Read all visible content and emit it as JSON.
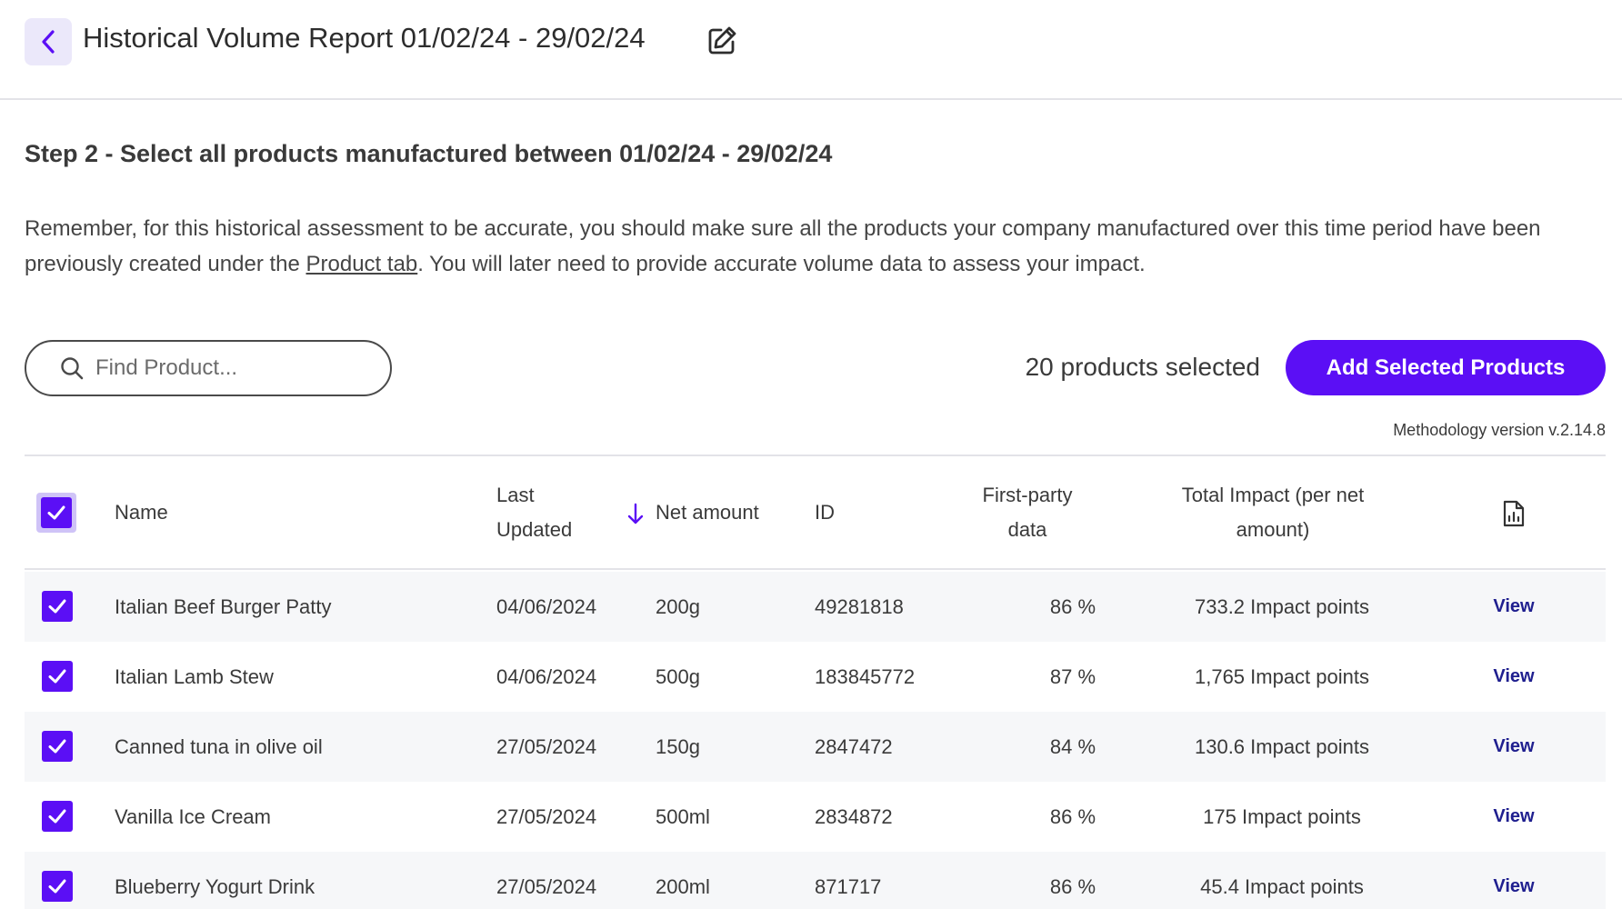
{
  "header": {
    "title": "Historical Volume Report 01/02/24 - 29/02/24"
  },
  "step": {
    "title": "Step 2 - Select all products manufactured between 01/02/24 - 29/02/24",
    "info_before": "Remember, for this historical assessment to be accurate, you should make sure all the products your company manufactured over this time period have been previously created under the ",
    "info_link": "Product tab",
    "info_after": ". You will later need to provide accurate volume data to assess your impact."
  },
  "search": {
    "placeholder": "Find Product..."
  },
  "selection": {
    "count_text": "20 products selected",
    "add_button": "Add Selected Products"
  },
  "methodology": "Methodology version v.2.14.8",
  "table": {
    "columns": {
      "name": "Name",
      "last_updated_1": "Last",
      "last_updated_2": "Updated",
      "net_amount": "Net amount",
      "id": "ID",
      "first_party_1": "First-party",
      "first_party_2": "data",
      "impact_1": "Total Impact (per net",
      "impact_2": "amount)"
    },
    "sort_icon": "arrow-down-icon",
    "report_icon": "document-chart-icon",
    "rows": [
      {
        "name": "Italian Beef Burger Patty",
        "updated": "04/06/2024",
        "net": "200g",
        "id": "49281818",
        "first_party": "86 %",
        "impact": "733.2 Impact points",
        "action": "View",
        "checked": true
      },
      {
        "name": "Italian Lamb Stew",
        "updated": "04/06/2024",
        "net": "500g",
        "id": "183845772",
        "first_party": "87 %",
        "impact": "1,765 Impact points",
        "action": "View",
        "checked": true
      },
      {
        "name": "Canned tuna in olive oil",
        "updated": "27/05/2024",
        "net": "150g",
        "id": "2847472",
        "first_party": "84 %",
        "impact": "130.6 Impact points",
        "action": "View",
        "checked": true
      },
      {
        "name": "Vanilla Ice Cream",
        "updated": "27/05/2024",
        "net": "500ml",
        "id": "2834872",
        "first_party": "86 %",
        "impact": "175 Impact points",
        "action": "View",
        "checked": true
      },
      {
        "name": "Blueberry Yogurt Drink",
        "updated": "27/05/2024",
        "net": "200ml",
        "id": "871717",
        "first_party": "86 %",
        "impact": "45.4 Impact points",
        "action": "View",
        "checked": true
      }
    ]
  },
  "colors": {
    "accent": "#5b0ff5",
    "link": "#1f1f8f",
    "row_alt": "#f6f7f9"
  }
}
